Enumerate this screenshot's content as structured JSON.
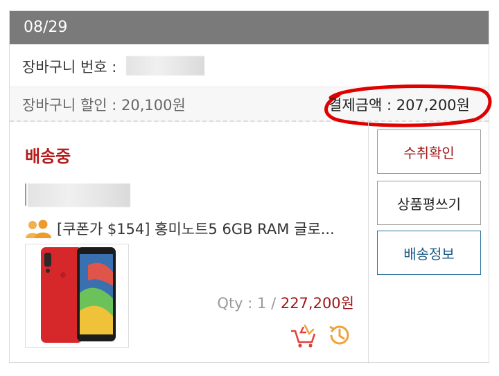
{
  "order": {
    "date": "08/29",
    "cart_number_label": "장바구니 번호 :",
    "discount_text": "장바구니 할인 : 20,100원",
    "payment_text": "결제금액 : 207,200원"
  },
  "item": {
    "status": "배송중",
    "name": "[쿠폰가 $154] 홍미노트5 6GB RAM 글로...",
    "qty_text": "Qty : 1 / ",
    "price": "227,200원",
    "icons": [
      "group-buy-icon",
      "add-to-cart-icon",
      "history-icon"
    ]
  },
  "actions": {
    "confirm_receipt": "수취확인",
    "write_review": "상품평쓰기",
    "shipping_info": "배송정보"
  },
  "colors": {
    "header_bg": "#7a7a7a",
    "status_red": "#b31a1a",
    "price_red": "#a01818",
    "shipping_blue": "#2a6f9c",
    "icon_orange": "#f0a23a",
    "annotation_red": "#e00000"
  }
}
